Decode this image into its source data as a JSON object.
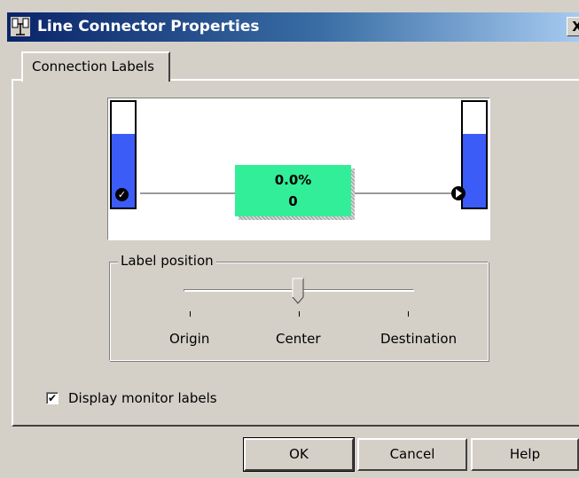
{
  "window": {
    "title": "Line Connector Properties",
    "close_symbol": "X",
    "app_icon": "connector-app-icon"
  },
  "tabs": [
    {
      "label": "Connection Labels",
      "active": true
    }
  ],
  "preview": {
    "source_tank_level": 0.7,
    "destination_tank_level": 0.7,
    "tank_fill_color": "#3b5cf7",
    "label_background": "#33ee99",
    "label_line1": "0.0%",
    "label_line2": "0",
    "source_marker_icon": "checkmark-icon",
    "source_marker_glyph": "✓",
    "destination_marker_icon": "arrow-right-icon"
  },
  "label_position": {
    "group_label": "Label position",
    "options": [
      "Origin",
      "Center",
      "Destination"
    ],
    "selected": "Center"
  },
  "display_monitor_labels": {
    "label": "Display monitor labels",
    "checked": true,
    "check_glyph": "✔"
  },
  "buttons": {
    "ok": "OK",
    "cancel": "Cancel",
    "help": "Help"
  },
  "colors": {
    "title_gradient_start": "#0a246a",
    "dialog_background": "#d4d0c8"
  }
}
